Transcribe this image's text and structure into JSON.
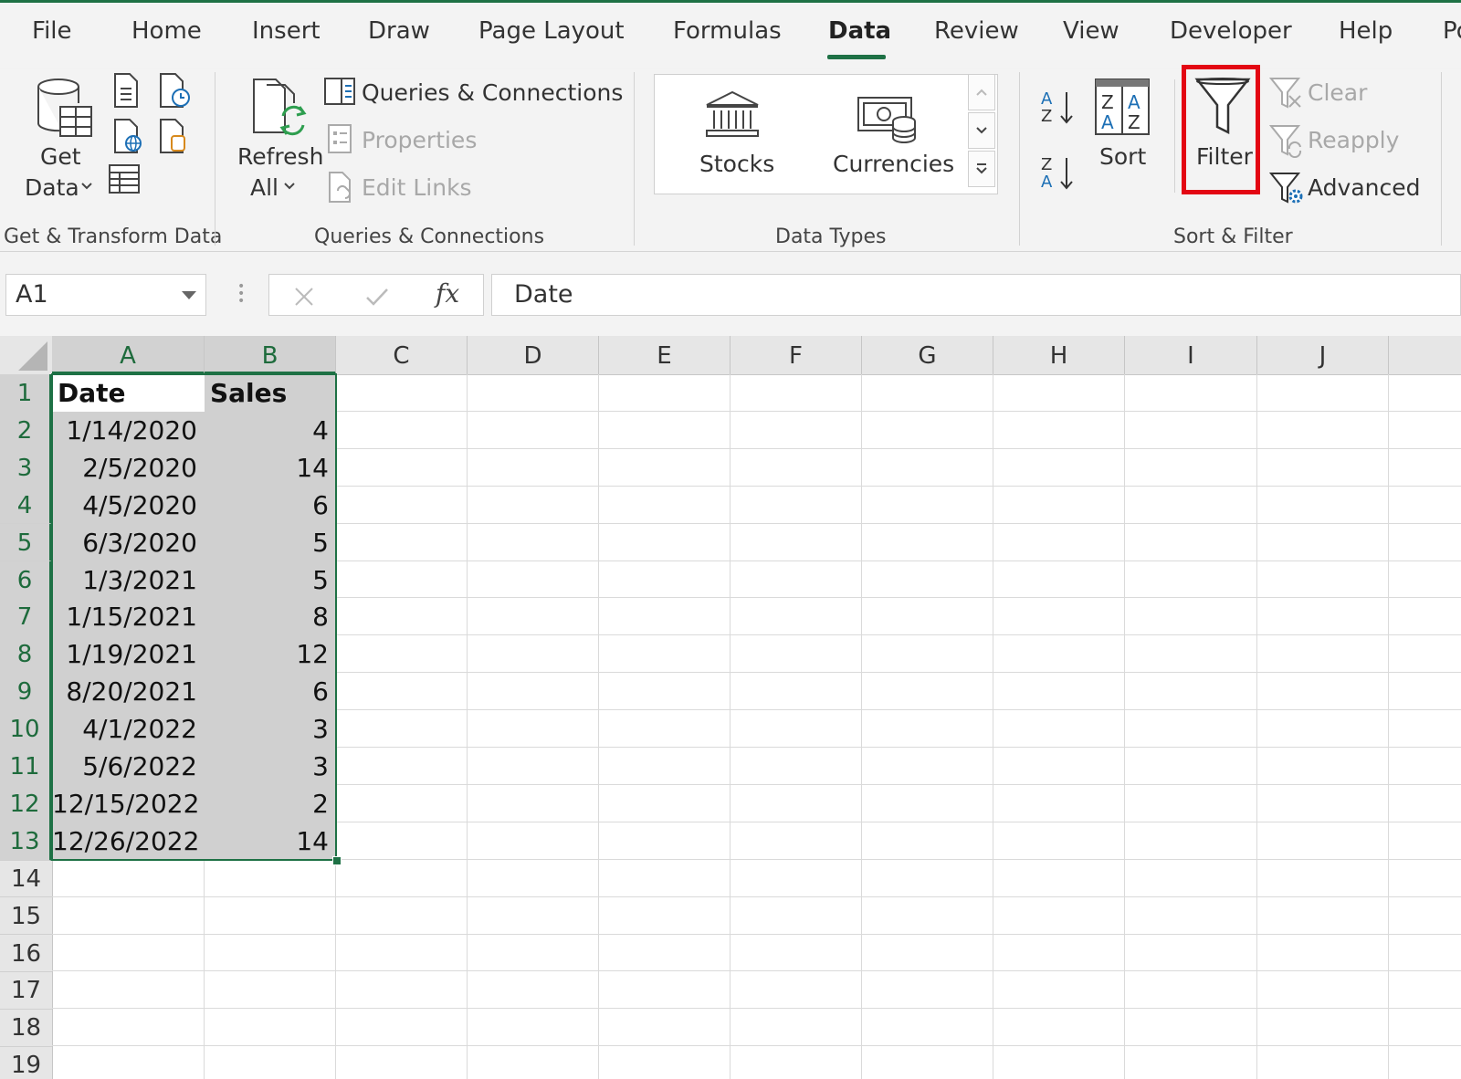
{
  "ribbon": {
    "tabs": [
      "File",
      "Home",
      "Insert",
      "Draw",
      "Page Layout",
      "Formulas",
      "Data",
      "Review",
      "View",
      "Developer",
      "Help",
      "Po"
    ],
    "active_tab": "Data",
    "groups": {
      "get_transform": {
        "label": "Get & Transform Data",
        "get_data": [
          "Get",
          "Data"
        ]
      },
      "queries": {
        "label": "Queries & Connections",
        "refresh_all": [
          "Refresh",
          "All"
        ],
        "queries_connections": "Queries & Connections",
        "properties": "Properties",
        "edit_links": "Edit Links"
      },
      "data_types": {
        "label": "Data Types",
        "stocks": "Stocks",
        "currencies": "Currencies"
      },
      "sort_filter": {
        "label": "Sort & Filter",
        "sort": "Sort",
        "filter": "Filter",
        "clear": "Clear",
        "reapply": "Reapply",
        "advanced": "Advanced"
      }
    }
  },
  "formula_bar": {
    "name_box": "A1",
    "fx": "fx",
    "value": "Date"
  },
  "sheet": {
    "columns": [
      "A",
      "B",
      "C",
      "D",
      "E",
      "F",
      "G",
      "H",
      "I",
      "J"
    ],
    "row_numbers": [
      "1",
      "2",
      "3",
      "4",
      "5",
      "6",
      "7",
      "8",
      "9",
      "10",
      "11",
      "12",
      "13",
      "14",
      "15",
      "16",
      "17",
      "18",
      "19"
    ],
    "headers": [
      "Date",
      "Sales"
    ],
    "rows": [
      [
        "1/14/2020",
        "4"
      ],
      [
        "2/5/2020",
        "14"
      ],
      [
        "4/5/2020",
        "6"
      ],
      [
        "6/3/2020",
        "5"
      ],
      [
        "1/3/2021",
        "5"
      ],
      [
        "1/15/2021",
        "8"
      ],
      [
        "1/19/2021",
        "12"
      ],
      [
        "8/20/2021",
        "6"
      ],
      [
        "4/1/2022",
        "3"
      ],
      [
        "5/6/2022",
        "3"
      ],
      [
        "12/15/2022",
        "2"
      ],
      [
        "12/26/2022",
        "14"
      ]
    ]
  },
  "colors": {
    "accent_green": "#1e7145",
    "highlight_red": "#e30613",
    "ribbon_bg": "#f3f3f3"
  }
}
